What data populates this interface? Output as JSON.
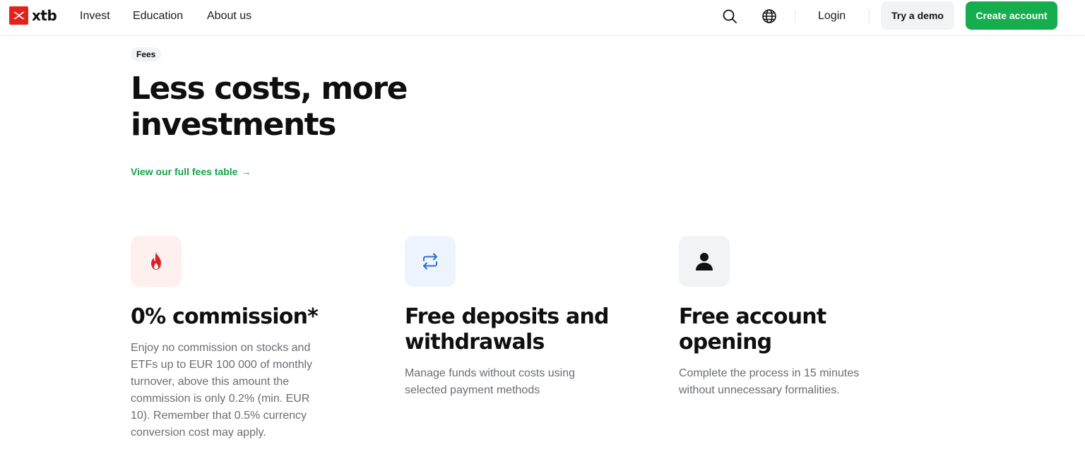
{
  "header": {
    "logo_text": "xtb",
    "nav": [
      "Invest",
      "Education",
      "About us"
    ],
    "login_label": "Login",
    "demo_label": "Try a demo",
    "create_label": "Create account",
    "icons": [
      "search-icon",
      "globe-icon"
    ]
  },
  "hero": {
    "tag": "Fees",
    "title": "Less costs, more investments",
    "fees_link": "View our full fees table",
    "fees_link_arrow": "→"
  },
  "features": [
    {
      "icon": "flame-icon",
      "title": "0% commission*",
      "description": "Enjoy no commission on stocks and ETFs up to EUR 100 000 of monthly turnover, above this amount the commission is only 0.2% (min. EUR 10). Remember that 0.5% currency conversion cost may apply."
    },
    {
      "icon": "transfer-arrows-icon",
      "title": "Free deposits and withdrawals",
      "description": "Manage funds without costs using selected payment methods"
    },
    {
      "icon": "user-icon",
      "title": "Free account opening",
      "description": "Complete the process in 15 minutes without unnecessary formalities."
    }
  ],
  "colors": {
    "brand_red": "#e2231a",
    "accent_green": "#15ad4e",
    "link_green": "#15a24a",
    "text_muted": "#6a6d73"
  }
}
